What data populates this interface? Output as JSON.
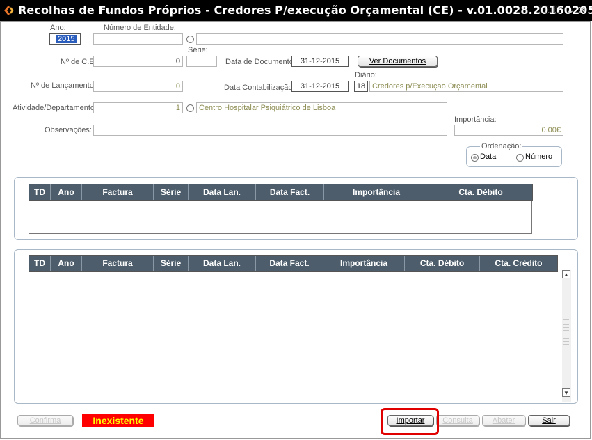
{
  "window": {
    "title": "Recolhas de Fundos Próprios - Credores P/execução Orçamental (CE) - v.01.0028.20160205",
    "dots": "░░░░░",
    "minimize_glyph": "⌄",
    "close_glyph": "✕"
  },
  "form": {
    "ano_label": "Ano:",
    "ano_value": "2015",
    "entidade_label": "Número de Entidade:",
    "entidade_value": "",
    "entidade_nome": "",
    "ce_label": "Nº de C.E:",
    "ce_value": "0",
    "serie_label": "Série:",
    "serie_value": "",
    "data_documento_label": "Data de Documento:",
    "data_documento_value": "31-12-2015",
    "ver_documentos_label": "Ver Documentos",
    "diario_label": "Diário:",
    "lancamento_label": "Nº de Lançamento:",
    "lancamento_value": "0",
    "data_contab_label": "Data Contabilização:",
    "data_contab_value": "31-12-2015",
    "diario_code": "18",
    "diario_nome": "Credores p/Execuçao Orçamental",
    "atividade_label": "Atividade/Departamento:",
    "atividade_code": "1",
    "atividade_nome": "Centro Hospitalar Psiquiátrico de Lisboa",
    "observacoes_label": "Observações:",
    "observacoes_value": "",
    "importancia_label": "Importância:",
    "importancia_value": "0.00€",
    "ordenacao_label": "Ordenação:",
    "ordenacao_options": [
      "Data",
      "Número"
    ],
    "ordenacao_selected": "Data"
  },
  "grid_top": {
    "columns": [
      "TD",
      "Ano",
      "Factura",
      "Série",
      "Data Lan.",
      "Data Fact.",
      "Importância",
      "Cta. Débito"
    ]
  },
  "grid_bottom": {
    "columns": [
      "TD",
      "Ano",
      "Factura",
      "Série",
      "Data Lan.",
      "Data Fact.",
      "Importância",
      "Cta. Débito",
      "Cta. Crédito"
    ]
  },
  "footer": {
    "confirma_label": "Confirma",
    "status_text": "Inexistente",
    "importar_label": "Importar",
    "consulta_label": "Consulta",
    "abater_label": "Abater",
    "sair_label": "Sair"
  },
  "colors": {
    "titlebar": "#000000",
    "grid_header": "#4d5d6b",
    "status_bg": "#ff0000",
    "status_text": "#ffff00",
    "highlight": "#e00000"
  }
}
